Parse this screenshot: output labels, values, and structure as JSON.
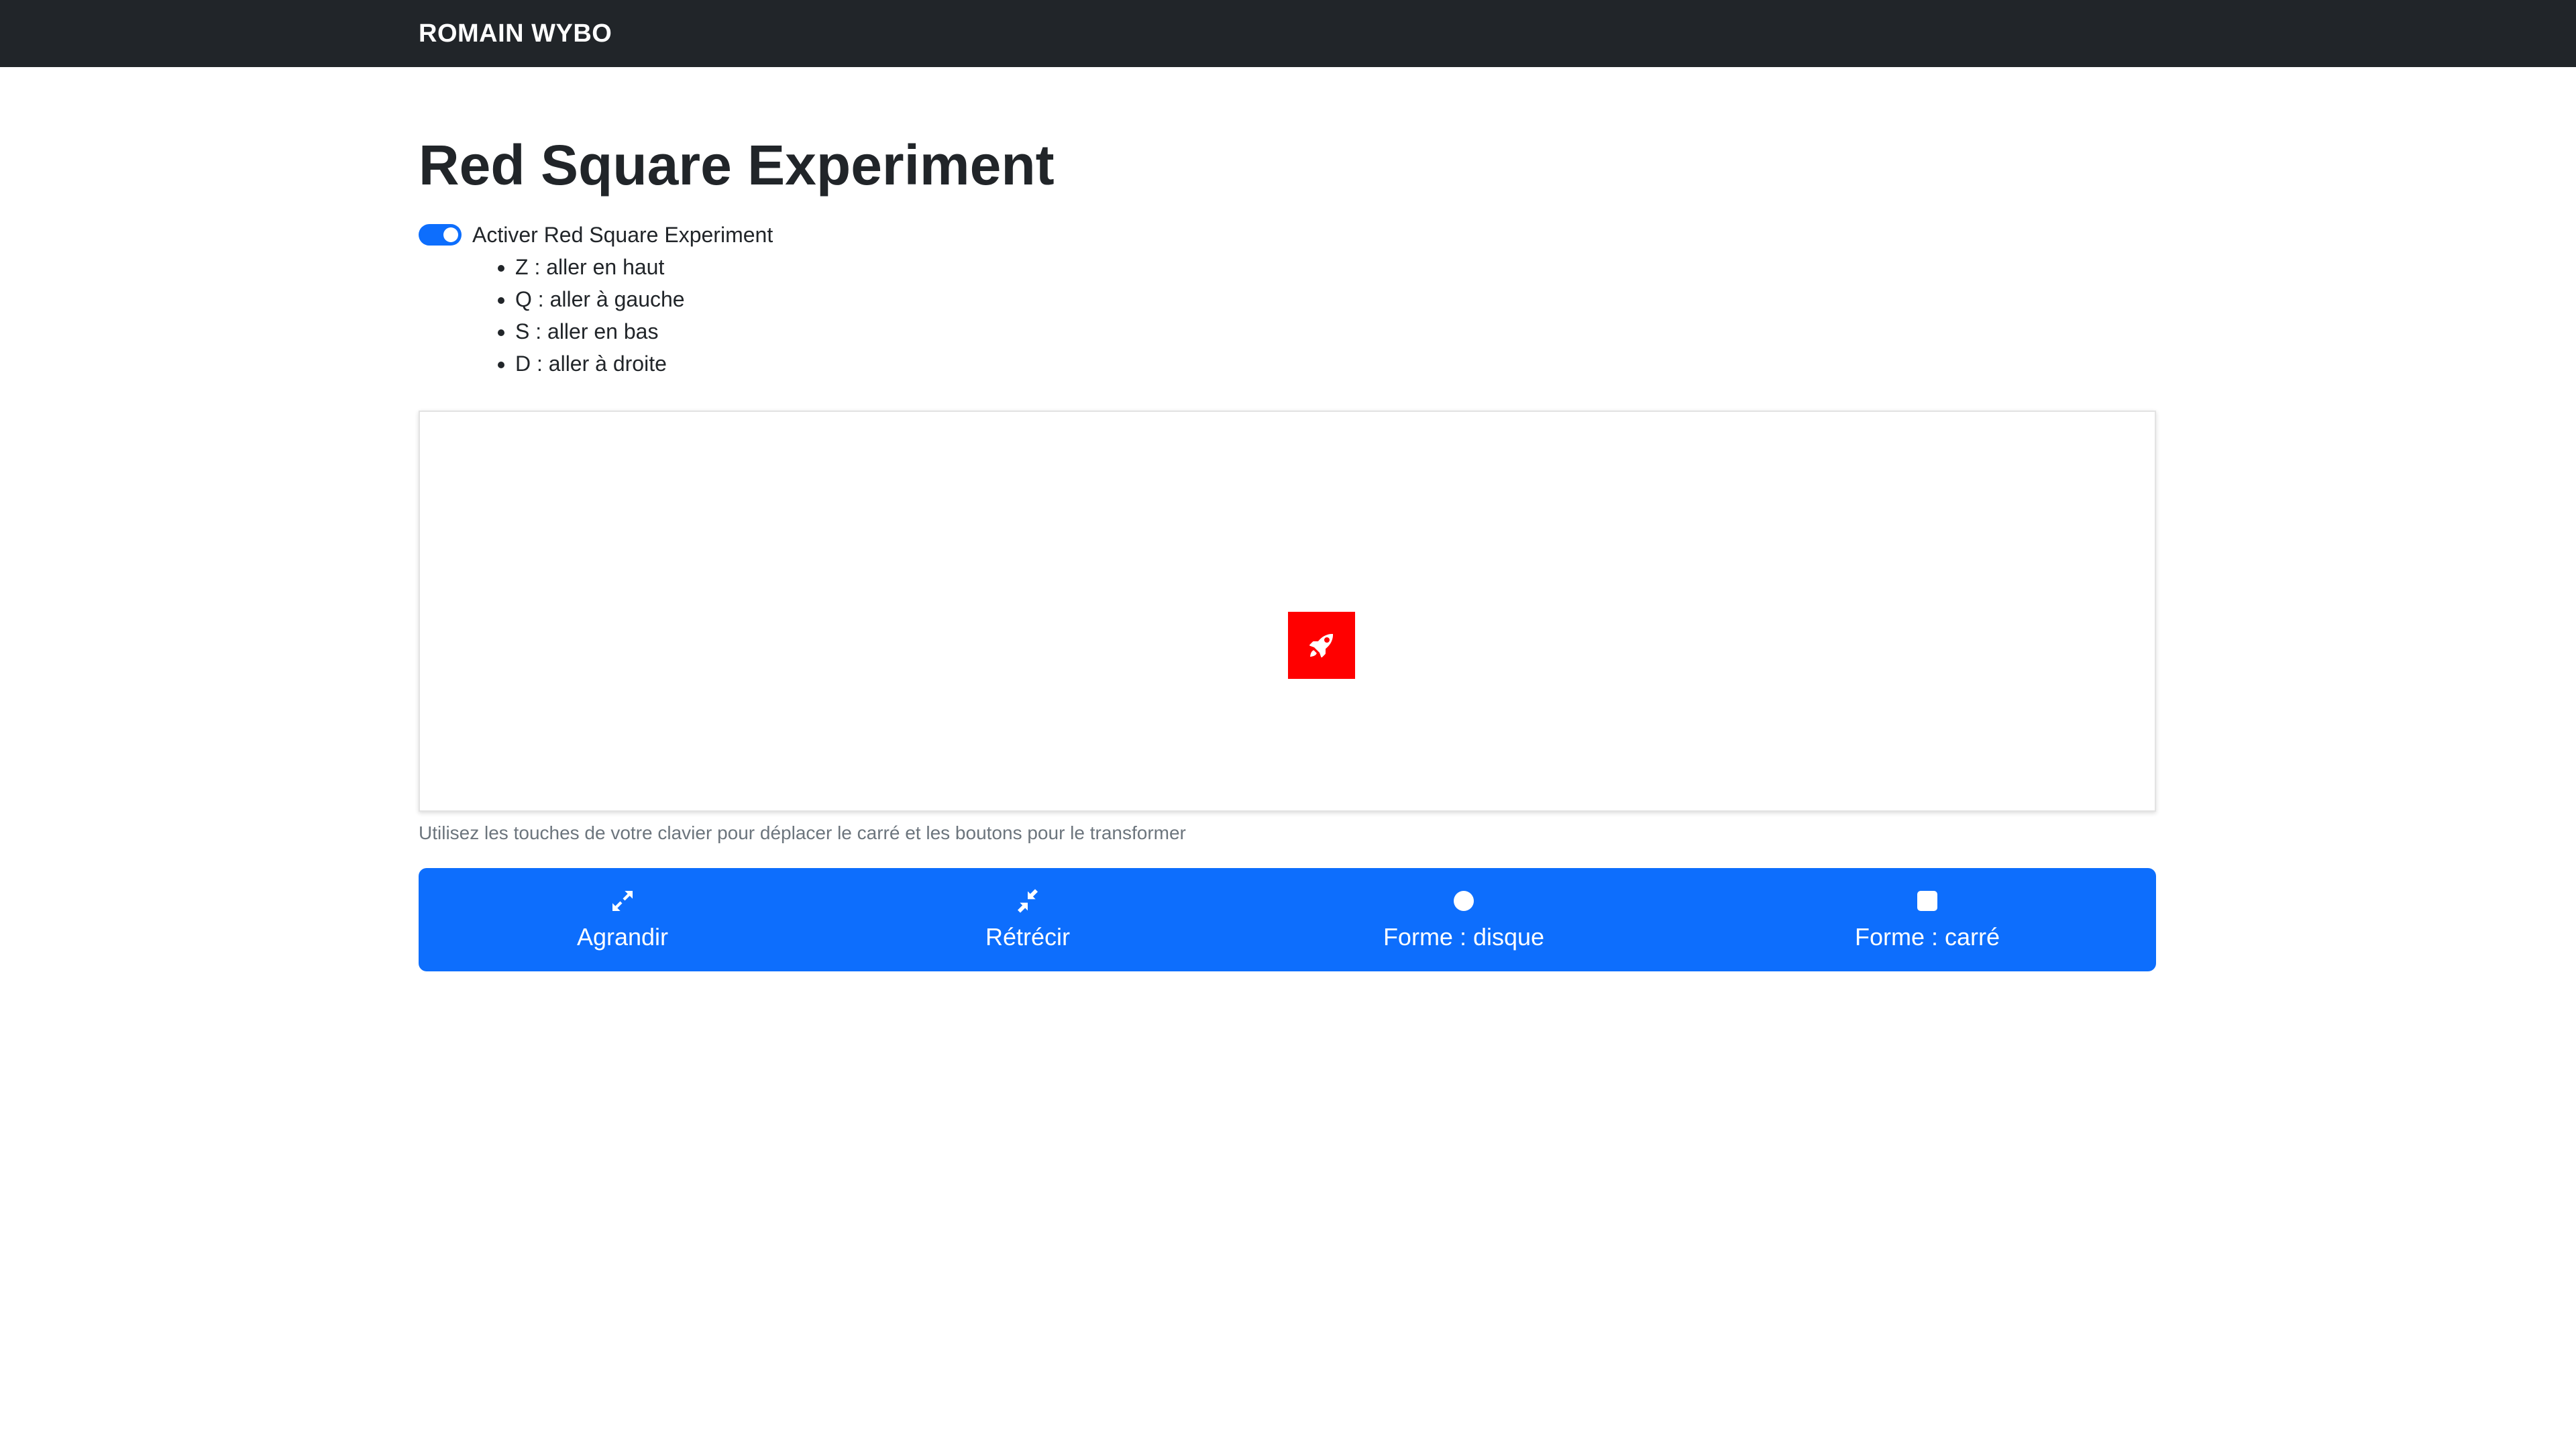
{
  "navbar": {
    "brand": "ROMAIN WYBO"
  },
  "page": {
    "title": "Red Square Experiment"
  },
  "toggle": {
    "label": "Activer Red Square Experiment",
    "enabled": true
  },
  "controls": [
    {
      "text": "Z : aller en haut"
    },
    {
      "text": "Q : aller à gauche"
    },
    {
      "text": "S : aller en bas"
    },
    {
      "text": "D : aller à droite"
    }
  ],
  "stage": {
    "square_color": "#ff0000",
    "square_icon": "rocket-icon"
  },
  "hint": "Utilisez les touches de votre clavier pour déplacer le carré et les boutons pour le transformer",
  "toolbar": {
    "color": "#0d6efd",
    "buttons": [
      {
        "label": "Agrandir",
        "icon": "expand-icon"
      },
      {
        "label": "Rétrécir",
        "icon": "compress-icon"
      },
      {
        "label": "Forme : disque",
        "icon": "circle-icon"
      },
      {
        "label": "Forme : carré",
        "icon": "square-icon"
      }
    ]
  }
}
